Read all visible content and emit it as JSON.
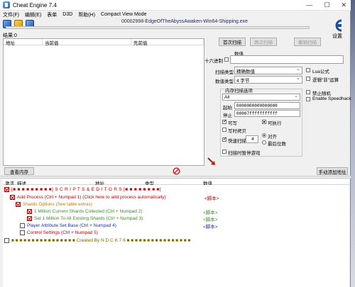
{
  "window": {
    "title": "Cheat Engine 7.4"
  },
  "menu": [
    "文件(F)",
    "编辑(E)",
    "表单",
    "D3D",
    "帮助(H)",
    "Compact View Mode"
  ],
  "process_name": "00002998-EdgeOfTheAbyssAwaken-Win64-Shipping.exe",
  "found_count": "结果:0",
  "settings_label": "设置",
  "results_headers": [
    "地址",
    "当前值",
    "先前值"
  ],
  "buttons": {
    "first_scan": "首次扫描",
    "next_scan": "再次扫描",
    "undo_scan": "撤销扫描",
    "view_memory": "查看内存",
    "add_address": "手动添加地址"
  },
  "scan": {
    "value_label": "数值",
    "hex_label": "十六进制",
    "scan_type_label": "扫描类型",
    "scan_type": "精确数值",
    "value_type_label": "数值类型",
    "value_type": "4 字节",
    "mem_options_label": "内存扫描选项",
    "region": "All",
    "start_label": "起始",
    "start_value": "0000000000000000",
    "stop_label": "停止",
    "stop_value": "00007fffffffffff",
    "writable": "可写",
    "executable": "可执行",
    "copy_on_write": "写时拷贝",
    "fast_scan": "快速扫描",
    "fast_scan_value": "4",
    "alignment": "对齐",
    "last_digits": "最后位数",
    "pause_game": "扫描时暂停游戏",
    "lua_formula": "Lua公式",
    "not_logic": "逻辑\"非\"运算",
    "disable_random": "禁止随机",
    "speedhack": "Enable Speedhack"
  },
  "table_headers": [
    "激活",
    "描述",
    "地址",
    "类型",
    "数值"
  ],
  "table_rows": [
    {
      "desc": "[■ ■ ■ ■ ■ ■ ■ ■ ■]  S  C  R  I  P  T  S    &    E  D  I  T  O  R  S  [■ ■ ■ ■ ■ ■ ■ ■]",
      "value": "",
      "color": "#c00000"
    },
    {
      "desc": "Add Process (Ctrl + Numpad 1) (Click here to add process automatically)",
      "value": "<脚本>",
      "color": "#c00000"
    },
    {
      "desc": "Shards Options (See table extras)",
      "value": "",
      "color": "#c47a00"
    },
    {
      "desc": "1 Million Currenr Shards Collected (Ctrl + Numpad 2)",
      "value": "<脚本>",
      "color": "#3a8f2a"
    },
    {
      "desc": "Set 1 Million To All Existing Shards (Ctrl + Numpad 3)",
      "value": "<脚本>",
      "color": "#3a8f2a"
    },
    {
      "desc": "Player Attribute Set Base (Ctrl + Numpad 4)",
      "value": "<脚本>",
      "color": "#1a2fa8"
    },
    {
      "desc": "Control Settings (Ctrl + Numpad 5)",
      "value": "",
      "color": "#c00000"
    },
    {
      "desc": "■ ■ ■ ■ ■ ■ ■ ■ ■ ■ ■ ■ ■ ■ ■ ■    Created    By    N D C K 7 6    ■ ■ ■ ■ ■ ■ ■ ■ ■ ■ ■ ■ ■ ■ ■ ■",
      "value": "",
      "color": "#7a6a00"
    }
  ]
}
